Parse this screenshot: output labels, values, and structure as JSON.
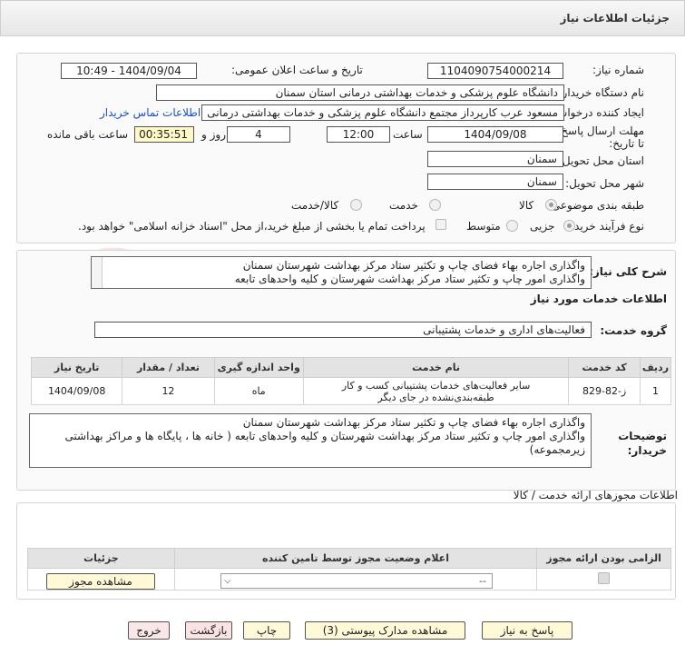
{
  "header": {
    "title": "جزئيات اطلاعات نياز"
  },
  "fields": {
    "need_number_label": "شماره نياز:",
    "need_number": "1104090754000214",
    "announce_datetime_label": "تاريخ و ساعت اعلان عمومی:",
    "announce_datetime": "1404/09/04 - 10:49",
    "buyer_org_label": "نام دستگاه خريدار:",
    "buyer_org": "دانشگاه علوم پزشکی و خدمات بهداشتی  درمانی استان سمنان",
    "requester_label": "ايجاد کننده درخواست:",
    "requester": "مسعود عرب کارپرداز مجتمع دانشگاه علوم پزشکی و خدمات بهداشتی  درمانی",
    "contact_link": "اطلاعات تماس خريدار",
    "deadline_label": "مهلت ارسال پاسخ: تا تاريخ:",
    "deadline_date": "1404/09/08",
    "time_label": "ساعت",
    "deadline_time": "12:00",
    "days_value": "4",
    "days_label": "روز و",
    "remaining_time": "00:35:51",
    "remaining_label": "ساعت باقی مانده",
    "delivery_province_label": "استان محل تحويل:",
    "delivery_province": "سمنان",
    "delivery_city_label": "شهر محل تحويل:",
    "delivery_city": "سمنان",
    "category_label": "طبقه بندی موضوعی:",
    "category_options": [
      "کالا",
      "خدمت",
      "کالا/خدمت"
    ],
    "process_label": "نوع فرآيند خريد :",
    "process_options": [
      "جزيی",
      "متوسط"
    ],
    "payment_note": "پرداخت تمام يا بخشی از مبلغ خريد،از محل \"اسناد خزانه اسلامی\" خواهد بود."
  },
  "description": {
    "label": "شرح کلی نياز:",
    "lines": [
      "واگذاری اجاره بهاء فضای چاپ و تکثیر ستاد مرکز بهداشت شهرستان سمنان",
      "واگذاری امور چاپ و تکثیر ستاد مرکز بهداشت شهرستان و کلیه واحدهای تابعه"
    ]
  },
  "services": {
    "section_title": "اطلاعات خدمات مورد نياز",
    "group_label": "گروه خدمت:",
    "group_value": "فعاليت‌های اداری و خدمات پشتيبانی",
    "columns": [
      "رديف",
      "کد خدمت",
      "نام خدمت",
      "واحد اندازه گيری",
      "تعداد / مقدار",
      "تاريخ نياز"
    ],
    "rows": [
      {
        "index": "1",
        "code": "ز-82-829",
        "name_line1": "ساير فعاليت‌های خدمات پشتيبانی کسب و کار",
        "name_line2": "طبقه‌بندی‌نشده در جای ديگر",
        "unit": "ماه",
        "qty": "12",
        "date": "1404/09/08"
      }
    ]
  },
  "buyer_notes": {
    "label": "توضيحات خريدار:",
    "lines": [
      "واگذاری اجاره بهاء فضای چاپ و تکثیر ستاد مرکز بهداشت شهرستان سمنان",
      "واگذاری امور چاپ و تکثیر ستاد مرکز بهداشت شهرستان و کلیه واحدهای تابعه ( خانه ها ، پایگاه ها و مراکز بهداشتی",
      "زیرمجموعه)"
    ]
  },
  "permits": {
    "section_title": "اطلاعات مجوزهای ارائه خدمت / کالا",
    "columns": [
      "الزامی بودن ارائه مجوز",
      "اعلام وضعيت مجوز توسط تامين کننده",
      "جزئيات"
    ],
    "select_value": "--",
    "view_button": "مشاهده مجوز"
  },
  "footer": {
    "reply": "پاسخ به نياز",
    "attachments": "مشاهده مدارک پيوستی (3)",
    "print": "چاپ",
    "back": "بازگشت",
    "exit": "خروج"
  },
  "colors": {
    "link": "#1e50c8",
    "yellow_field": "#fff9c8",
    "watermark": "#c0392b"
  }
}
